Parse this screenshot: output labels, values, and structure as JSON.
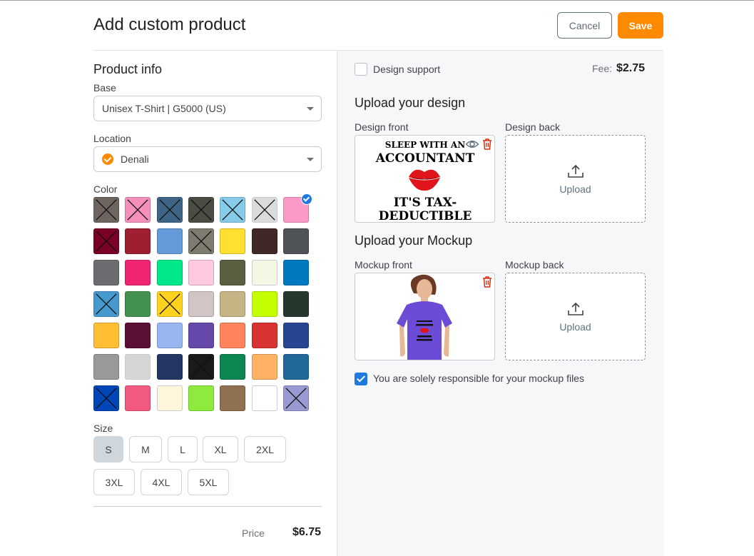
{
  "header": {
    "title": "Add custom product",
    "cancel_label": "Cancel",
    "save_label": "Save"
  },
  "product_info": {
    "title": "Product info",
    "base_label": "Base",
    "base_value": "Unisex T-Shirt | G5000 (US)",
    "location_label": "Location",
    "location_value": "Denali",
    "color_label": "Color",
    "colors": [
      {
        "hex": "#6e6560",
        "crossed": true
      },
      {
        "hex": "#f490b9",
        "crossed": true
      },
      {
        "hex": "#3e6585",
        "crossed": true
      },
      {
        "hex": "#4a4d44",
        "crossed": true
      },
      {
        "hex": "#86cbe8",
        "crossed": true
      },
      {
        "hex": "#dbdbdb",
        "crossed": true
      },
      {
        "hex": "#fb99c8",
        "crossed": false,
        "selected": true
      },
      {
        "hex": "#7a0026",
        "crossed": true
      },
      {
        "hex": "#9e1e32",
        "crossed": false
      },
      {
        "hex": "#649ad9",
        "crossed": false
      },
      {
        "hex": "#7d7b70",
        "crossed": true
      },
      {
        "hex": "#ffe030",
        "crossed": false
      },
      {
        "hex": "#3f2825",
        "crossed": false
      },
      {
        "hex": "#4f5357",
        "crossed": false
      },
      {
        "hex": "#6c6d70",
        "crossed": false
      },
      {
        "hex": "#f02572",
        "crossed": false
      },
      {
        "hex": "#00e88a",
        "crossed": false
      },
      {
        "hex": "#ffcae0",
        "crossed": false
      },
      {
        "hex": "#5b5e41",
        "crossed": false
      },
      {
        "hex": "#f6f6e4",
        "crossed": false
      },
      {
        "hex": "#0079c1",
        "crossed": false
      },
      {
        "hex": "#4699ce",
        "crossed": true
      },
      {
        "hex": "#43914f",
        "crossed": false
      },
      {
        "hex": "#ffd21e",
        "crossed": true
      },
      {
        "hex": "#d2c5c5",
        "crossed": false
      },
      {
        "hex": "#c5b585",
        "crossed": false
      },
      {
        "hex": "#c4ff00",
        "crossed": false
      },
      {
        "hex": "#24382e",
        "crossed": false
      },
      {
        "hex": "#ffbe33",
        "crossed": false
      },
      {
        "hex": "#5b0e36",
        "crossed": false
      },
      {
        "hex": "#99b5ef",
        "crossed": false
      },
      {
        "hex": "#6648aa",
        "crossed": false
      },
      {
        "hex": "#ff845c",
        "crossed": false
      },
      {
        "hex": "#d83233",
        "crossed": false
      },
      {
        "hex": "#274691",
        "crossed": false
      },
      {
        "hex": "#999999",
        "crossed": false
      },
      {
        "hex": "#d6d6d6",
        "crossed": false
      },
      {
        "hex": "#243764",
        "crossed": false
      },
      {
        "hex": "#1a1a1a",
        "crossed": true
      },
      {
        "hex": "#0d8751",
        "crossed": false
      },
      {
        "hex": "#ffb164",
        "crossed": false
      },
      {
        "hex": "#1f6898",
        "crossed": false
      },
      {
        "hex": "#0146b8",
        "crossed": true
      },
      {
        "hex": "#f2597f",
        "crossed": false
      },
      {
        "hex": "#fff6dc",
        "crossed": false
      },
      {
        "hex": "#8eea3c",
        "crossed": false
      },
      {
        "hex": "#8f7050",
        "crossed": false
      },
      {
        "hex": "#ffffff",
        "crossed": false
      },
      {
        "hex": "#9a9ad2",
        "crossed": true
      }
    ],
    "size_label": "Size",
    "sizes": [
      "S",
      "M",
      "L",
      "XL",
      "2XL",
      "3XL",
      "4XL",
      "5XL"
    ],
    "selected_size": "S",
    "price_label": "Price",
    "price_value": "$6.75"
  },
  "design": {
    "support_label": "Design support",
    "support_checked": false,
    "fee_label": "Fee:",
    "fee_value": "$2.75",
    "upload_design_title": "Upload your design",
    "front_label": "Design front",
    "back_label": "Design back",
    "front_artwork": {
      "line1": "SLEEP WITH AN",
      "line2": "ACCOUNTANT",
      "line3": "IT'S TAX-",
      "line4": "DEDUCTIBLE"
    },
    "upload_label": "Upload"
  },
  "mockup": {
    "title": "Upload your Mockup",
    "front_label": "Mockup front",
    "back_label": "Mockup back",
    "upload_label": "Upload",
    "responsibility_text": "You are solely responsible for your mockup files",
    "responsibility_checked": true
  },
  "colors": {
    "accent_orange": "#ff8a00",
    "accent_blue": "#1f7ae0",
    "delete_red": "#d72c0d"
  }
}
